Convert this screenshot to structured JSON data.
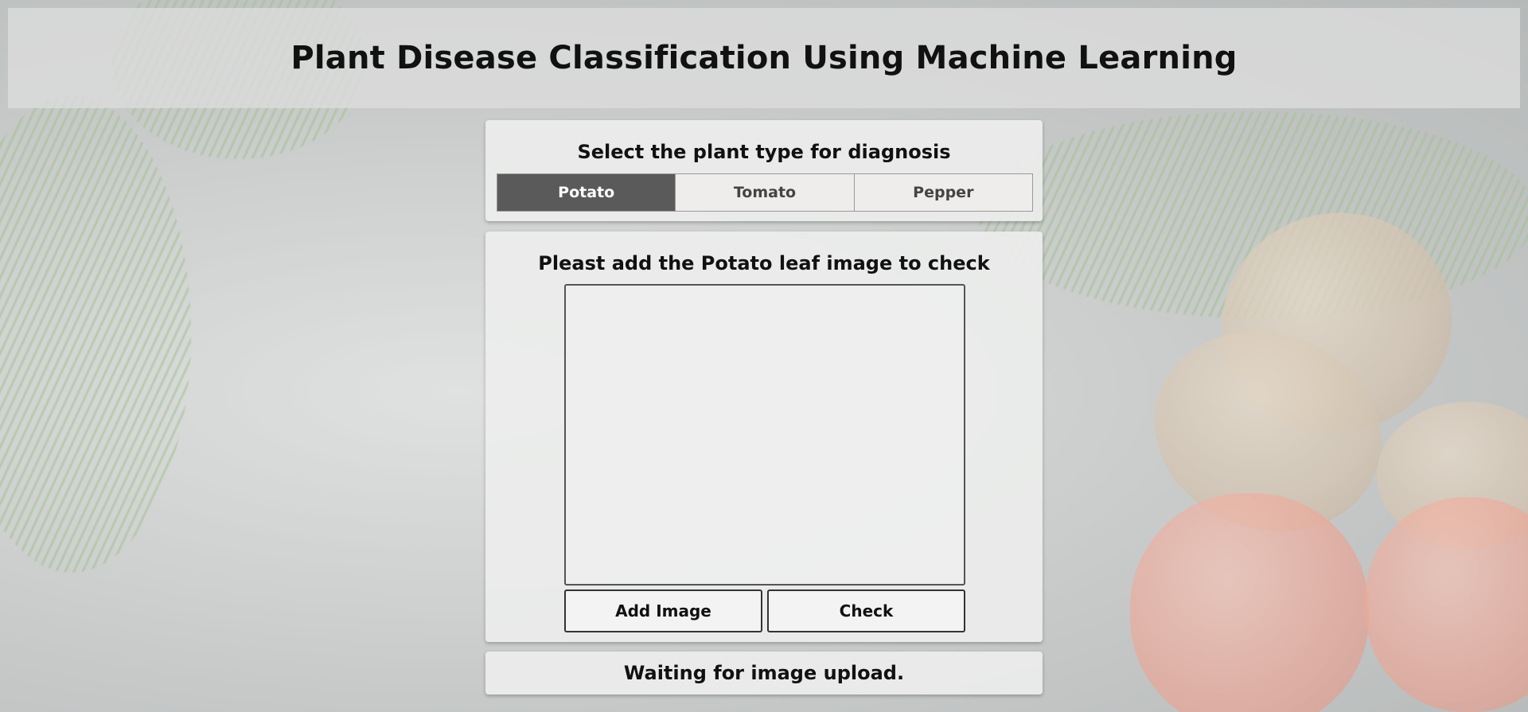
{
  "header": {
    "title": "Plant Disease Classification Using Machine Learning"
  },
  "plant_select": {
    "prompt": "Select the plant type for diagnosis",
    "options": [
      "Potato",
      "Tomato",
      "Pepper"
    ],
    "selected": "Potato"
  },
  "upload": {
    "prompt": "Pleast add the Potato leaf image to check",
    "add_image_label": "Add Image",
    "check_label": "Check"
  },
  "status": {
    "message": "Waiting for image upload."
  },
  "colors": {
    "selected_tab_bg": "#5b5a5b",
    "tab_bg": "#efecec",
    "panel_bg": "#ecedec"
  }
}
